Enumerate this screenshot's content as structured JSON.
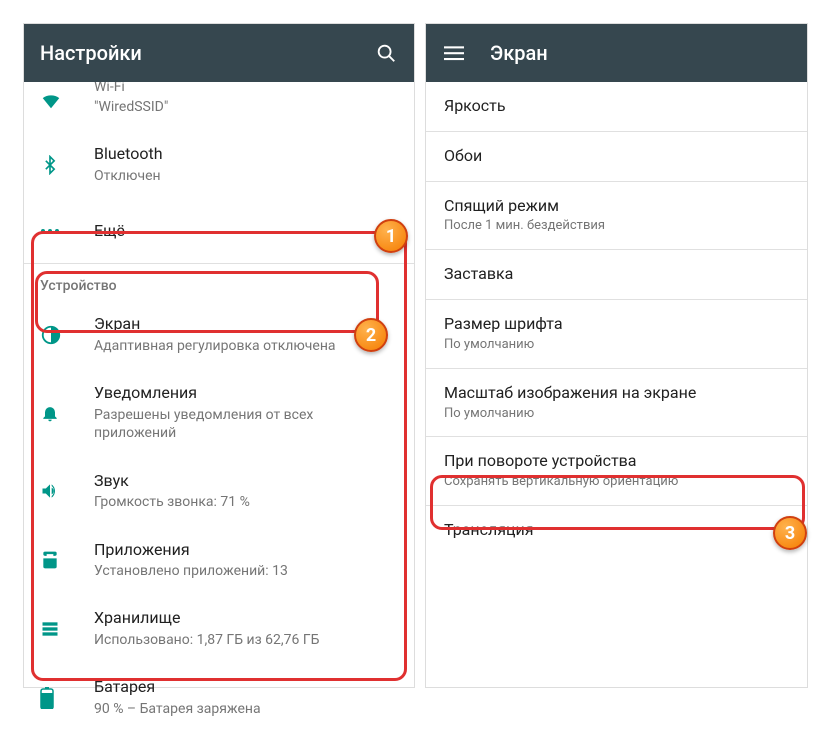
{
  "left": {
    "title": "Настройки",
    "wifi": {
      "title": "Wi-Fi",
      "sub": "\"WiredSSID\""
    },
    "bluetooth": {
      "title": "Bluetooth",
      "sub": "Отключен"
    },
    "more": {
      "title": "Ещё"
    },
    "sectionDevice": "Устройство",
    "display": {
      "title": "Экран",
      "sub": "Адаптивная регулировка отключена"
    },
    "notifications": {
      "title": "Уведомления",
      "sub": "Разрешены уведомления от всех приложений"
    },
    "sound": {
      "title": "Звук",
      "sub": "Громкость звонка: 71 %"
    },
    "apps": {
      "title": "Приложения",
      "sub": "Установлено приложений: 13"
    },
    "storage": {
      "title": "Хранилище",
      "sub": "Использовано: 1,87 ГБ из 62,76 ГБ"
    },
    "battery": {
      "title": "Батарея",
      "sub": "90 % – Батарея заряжена"
    }
  },
  "right": {
    "title": "Экран",
    "brightness": "Яркость",
    "wallpaper": "Обои",
    "sleep": {
      "title": "Спящий режим",
      "sub": "После 1 мин. бездействия"
    },
    "screensaver": "Заставка",
    "fontSize": {
      "title": "Размер шрифта",
      "sub": "По умолчанию"
    },
    "displayScale": {
      "title": "Масштаб изображения на экране",
      "sub": "По умолчанию"
    },
    "rotation": {
      "title": "При повороте устройства",
      "sub": "Сохранять вертикальную ориентацию"
    },
    "cast": "Трансляция"
  },
  "badges": {
    "b1": "1",
    "b2": "2",
    "b3": "3"
  }
}
